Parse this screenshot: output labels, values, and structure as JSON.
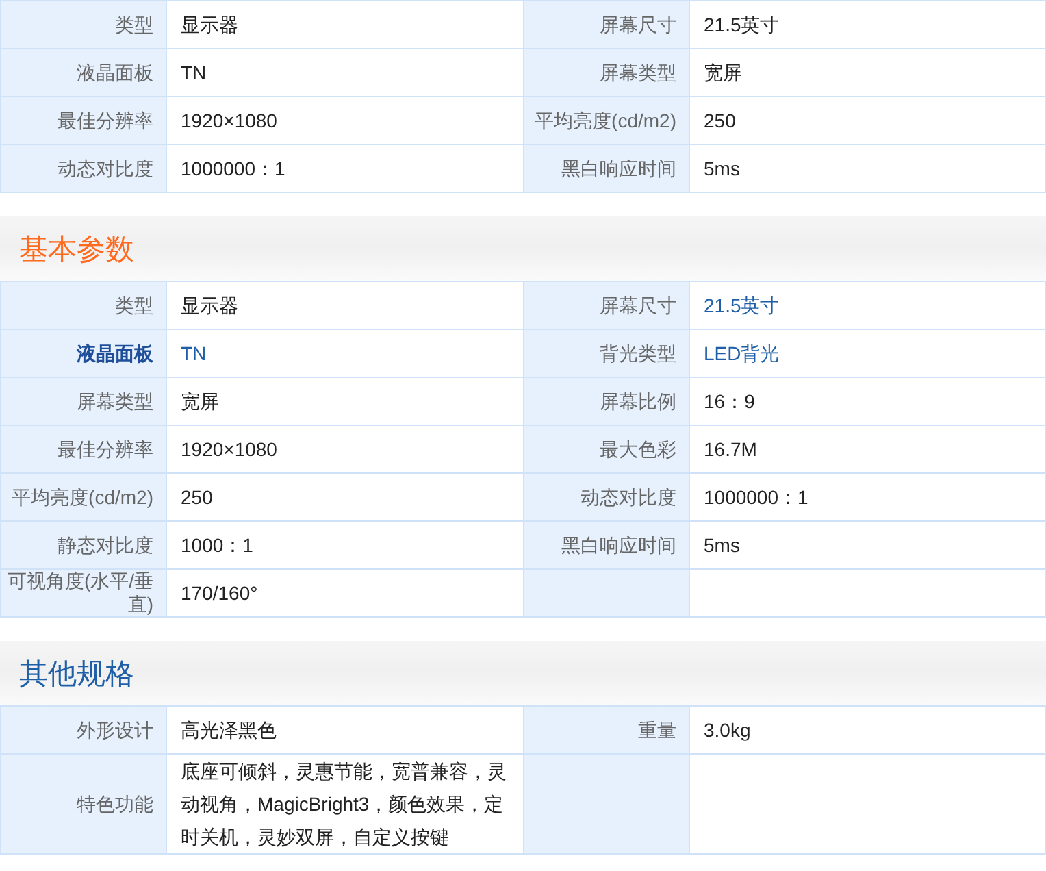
{
  "sections": [
    {
      "rows": [
        [
          {
            "label": "类型",
            "value": "显示器",
            "link": false
          },
          {
            "label": "屏幕尺寸",
            "value": "21.5英寸",
            "link": false
          }
        ],
        [
          {
            "label": "液晶面板",
            "value": "TN",
            "link": false
          },
          {
            "label": "屏幕类型",
            "value": "宽屏",
            "link": false
          }
        ],
        [
          {
            "label": "最佳分辨率",
            "value": "1920×1080",
            "link": false
          },
          {
            "label": "平均亮度(cd/m2)",
            "value": "250",
            "link": false
          }
        ],
        [
          {
            "label": "动态对比度",
            "value": "1000000：1",
            "link": false
          },
          {
            "label": "黑白响应时间",
            "value": "5ms",
            "link": false
          }
        ]
      ]
    },
    {
      "title": "基本参数",
      "color": "#ff6a1f",
      "rows": [
        [
          {
            "label": "类型",
            "value": "显示器",
            "link": false
          },
          {
            "label": "屏幕尺寸",
            "value": "21.5英寸",
            "link": true
          }
        ],
        [
          {
            "label": "液晶面板",
            "highlighted": true,
            "value": "TN",
            "link": true
          },
          {
            "label": "背光类型",
            "value": "LED背光",
            "link": true
          }
        ],
        [
          {
            "label": "屏幕类型",
            "value": "宽屏",
            "link": false
          },
          {
            "label": "屏幕比例",
            "value": "16：9",
            "link": false
          }
        ],
        [
          {
            "label": "最佳分辨率",
            "value": "1920×1080",
            "link": false
          },
          {
            "label": "最大色彩",
            "value": "16.7M",
            "link": false
          }
        ],
        [
          {
            "label": "平均亮度(cd/m2)",
            "value": "250",
            "link": false
          },
          {
            "label": "动态对比度",
            "value": "1000000：1",
            "link": false
          }
        ],
        [
          {
            "label": "静态对比度",
            "value": "1000：1",
            "link": false
          },
          {
            "label": "黑白响应时间",
            "value": "5ms",
            "link": false
          }
        ],
        [
          {
            "label": "可视角度(水平/垂直)",
            "value": "170/160°",
            "link": false
          }
        ]
      ]
    },
    {
      "title": "其他规格",
      "color": "#1f5fa8",
      "rows": [
        [
          {
            "label": "外形设计",
            "value": "高光泽黑色",
            "link": false
          },
          {
            "label": "重量",
            "value": "3.0kg",
            "link": false
          }
        ],
        [
          {
            "label": "特色功能",
            "value": "底座可倾斜，灵惠节能，宽普兼容，灵动视角，MagicBright3，颜色效果，定时关机，灵妙双屏，自定义按键",
            "link": false
          }
        ]
      ]
    }
  ]
}
